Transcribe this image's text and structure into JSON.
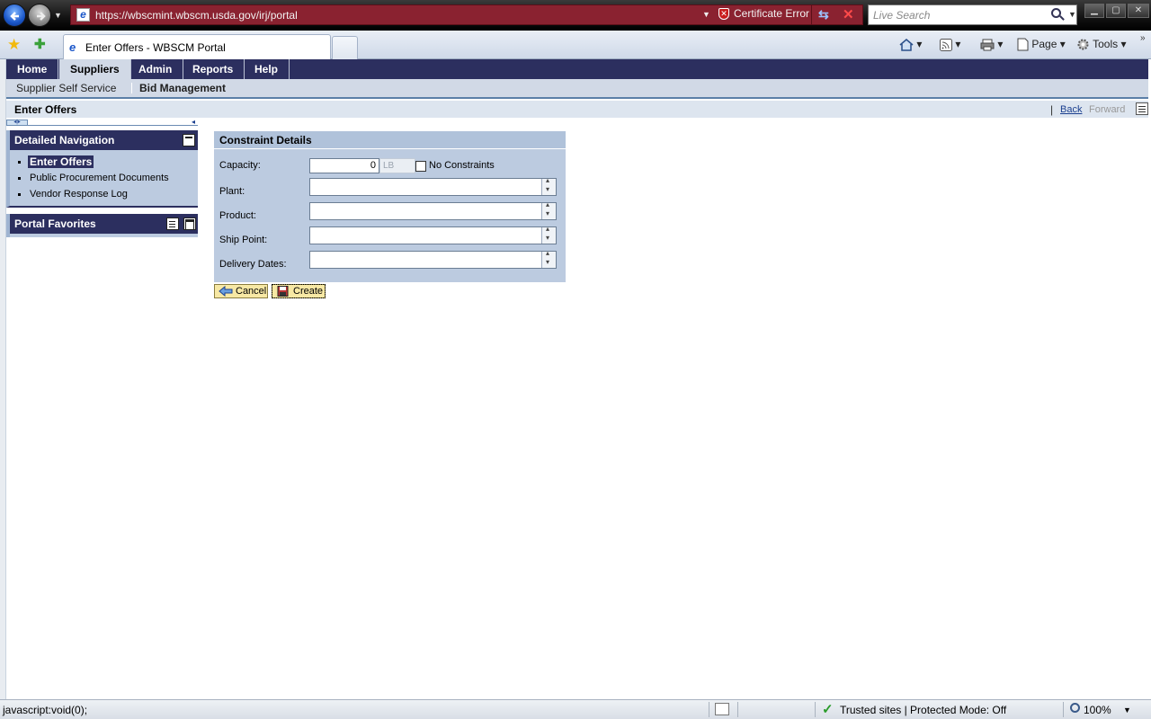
{
  "browser": {
    "url": "https://wbscmint.wbscm.usda.gov/irj/portal",
    "certificate_error": "Certificate Error",
    "search_placeholder": "Live Search",
    "tab_title": "Enter Offers - WBSCM Portal",
    "toolbar": {
      "page_label": "Page",
      "tools_label": "Tools"
    }
  },
  "portal": {
    "top_nav": [
      "Home",
      "Suppliers",
      "Admin",
      "Reports",
      "Help"
    ],
    "active_top_nav": "Suppliers",
    "sub_nav": [
      "Supplier Self Service",
      "Bid Management"
    ],
    "page_title": "Enter Offers",
    "history": {
      "back": "Back",
      "forward": "Forward"
    }
  },
  "detailed_navigation": {
    "title": "Detailed Navigation",
    "items": [
      {
        "label": "Enter Offers",
        "selected": true
      },
      {
        "label": "Public Procurement Documents",
        "selected": false
      },
      {
        "label": "Vendor Response Log",
        "selected": false
      }
    ]
  },
  "portal_favorites": {
    "title": "Portal Favorites"
  },
  "constraint_details": {
    "title": "Constraint Details",
    "capacity": {
      "label": "Capacity:",
      "value": "0",
      "unit": "LB"
    },
    "no_constraints_label": "No Constraints",
    "plant_label": "Plant:",
    "product_label": "Product:",
    "ship_point_label": "Ship Point:",
    "delivery_dates_label": "Delivery Dates:"
  },
  "buttons": {
    "cancel": "Cancel",
    "create": "Create"
  },
  "statusbar": {
    "text": "javascript:void(0);",
    "zone": "Trusted sites | Protected Mode: Off",
    "zoom": "100%"
  },
  "colors": {
    "portal_nav": "#2c2f5f",
    "panel_bg": "#bccbe0",
    "button_bg": "#f7e8a4",
    "address_error": "#8a2230"
  }
}
